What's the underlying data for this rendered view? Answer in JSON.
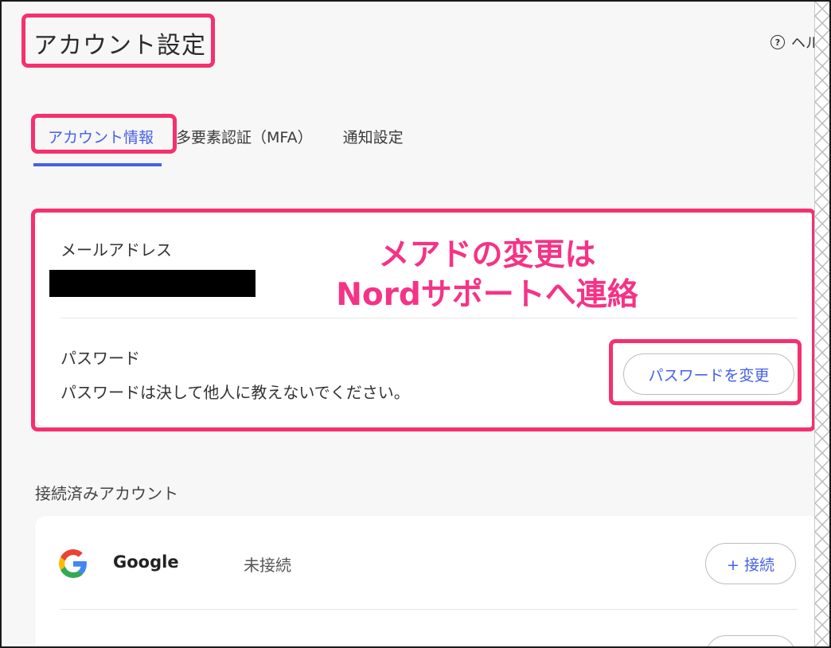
{
  "header": {
    "title": "アカウント設定",
    "help_label": "ヘル"
  },
  "tabs": [
    {
      "label": "アカウント情報",
      "active": true
    },
    {
      "label": "多要素認証（MFA）",
      "active": false
    },
    {
      "label": "通知設定",
      "active": false
    }
  ],
  "account": {
    "email_label": "メールアドレス",
    "password_label": "パスワード",
    "password_note": "パスワードは決して他人に教えないでください。",
    "change_password_button": "パスワードを変更"
  },
  "annotation": {
    "line1": "メアドの変更は",
    "line2": "Nordサポートへ連絡"
  },
  "connected": {
    "section_title": "接続済みアカウント",
    "items": [
      {
        "name": "Google",
        "status": "未接続",
        "button": "+ 接続",
        "icon": "google-icon"
      }
    ]
  },
  "colors": {
    "accent": "#4561e8",
    "highlight": "#f5306f",
    "annotation": "#f53386"
  }
}
